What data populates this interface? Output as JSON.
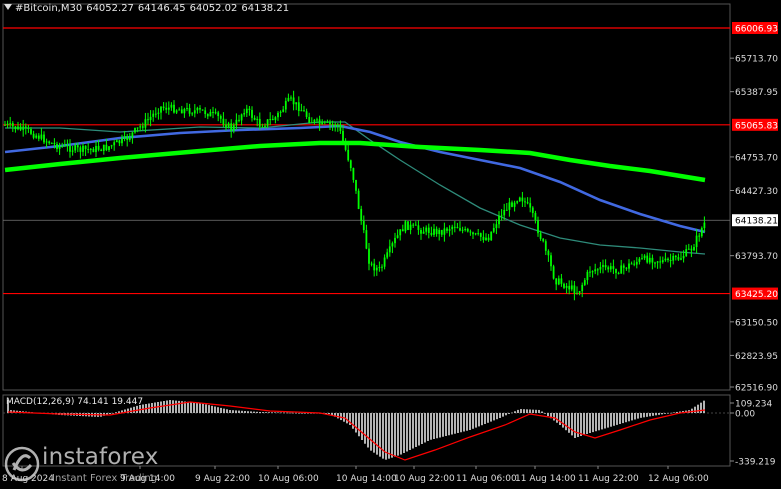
{
  "header": {
    "symbol": "#Bitcoin,M30",
    "open": "64052.27",
    "high": "64146.45",
    "low": "64052.02",
    "close": "64138.21"
  },
  "macd_label": "MACD(12,26,9) 74.141 19.447",
  "price_axis": {
    "ticks": [
      "65713.70",
      "65387.95",
      "64753.70",
      "64427.30",
      "63793.70",
      "63150.50",
      "62823.95",
      "62516.90"
    ],
    "levels": [
      {
        "label": "66006.93",
        "color": "#ff0000"
      },
      {
        "label": "65065.83",
        "color": "#ff0000"
      },
      {
        "label": "63425.20",
        "color": "#ff0000"
      }
    ],
    "current_price": "64138.21"
  },
  "macd_axis": {
    "ticks": [
      "109.234",
      "0.00",
      "-339.219"
    ]
  },
  "time_axis": {
    "labels": [
      "8 Aug 2024",
      "9 Aug 14:00",
      "9 Aug 22:00",
      "10 Aug 06:00",
      "10 Aug 14:00",
      "10 Aug 22:00",
      "11 Aug 06:00",
      "11 Aug 14:00",
      "11 Aug 22:00",
      "12 Aug 06:00"
    ]
  },
  "colors": {
    "background": "#000000",
    "candle": "#00ff00",
    "ma_fast": "#2e8b7a",
    "ma_mid": "#4169e1",
    "ma_slow": "#00ff00",
    "level_line": "#ff0000",
    "macd_hist": "#c8c8c8",
    "macd_signal": "#ff0000"
  },
  "logo": {
    "name": "instaforex",
    "tagline": "Instant Forex Trading"
  }
}
